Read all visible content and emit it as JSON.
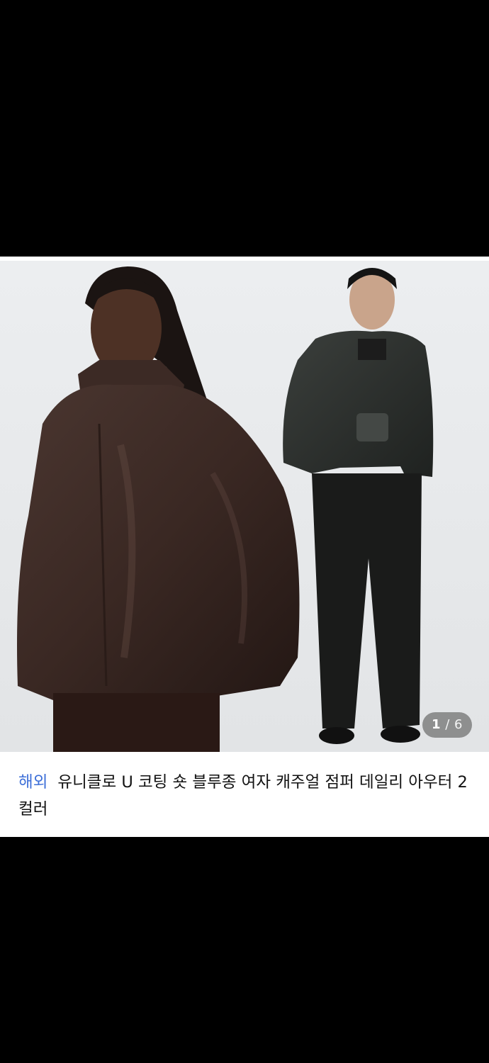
{
  "product": {
    "image_alt": "Two models wearing coated short blouson jackets",
    "counter": {
      "current": "1",
      "separator": "/",
      "total": "6"
    },
    "badge": "해외",
    "title": "유니클로 U 코팅 숏 블루종 여자 캐주얼 점퍼 데일리 아우터 2컬러"
  },
  "colors": {
    "badge": "#3d6fd8",
    "jacket_brown": "#3b2a25",
    "jacket_black": "#2d302d"
  }
}
